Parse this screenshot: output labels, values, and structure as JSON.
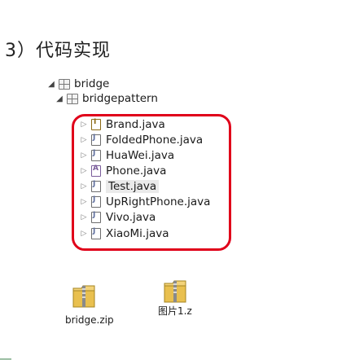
{
  "heading": "3）代码实现",
  "tree": {
    "root": {
      "label": "bridge"
    },
    "subpackage": {
      "label": "bridgepattern"
    },
    "files": [
      {
        "label": "Brand.java",
        "kind": "interface"
      },
      {
        "label": "FoldedPhone.java",
        "kind": "class"
      },
      {
        "label": "HuaWei.java",
        "kind": "class"
      },
      {
        "label": "Phone.java",
        "kind": "abstract"
      },
      {
        "label": "Test.java",
        "kind": "class"
      },
      {
        "label": "UpRightPhone.java",
        "kind": "class"
      },
      {
        "label": "Vivo.java",
        "kind": "class"
      },
      {
        "label": "XiaoMi.java",
        "kind": "class"
      }
    ],
    "selected_index": 4
  },
  "desktop": {
    "zip_label": "bridge.zip",
    "folder_label": "图片1.z"
  },
  "colors": {
    "highlight": "#e0001a",
    "folder": "#d8b24a"
  }
}
